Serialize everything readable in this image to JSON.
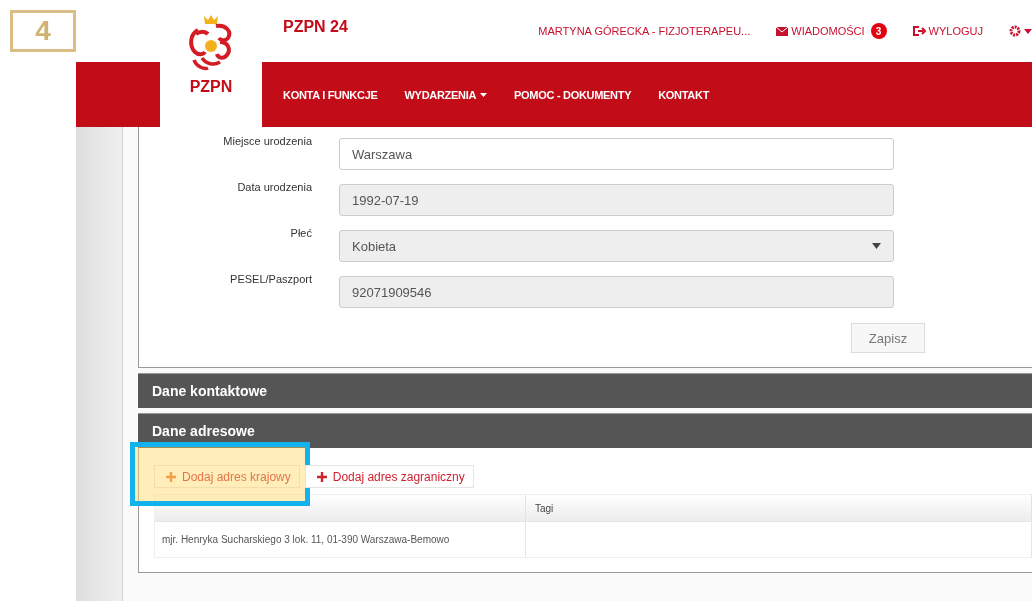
{
  "step_badge": "4",
  "header": {
    "logo_text": "PZPN",
    "app_title": "PZPN 24",
    "user": "MARTYNA GÓRECKA - FIZJOTERAPEU...",
    "messages": {
      "label": "WIADOMOŚCI",
      "count": "3"
    },
    "logout": "WYLOGUJ"
  },
  "nav": [
    {
      "label": "KONTA I FUNKCJE",
      "dropdown": false
    },
    {
      "label": "WYDARZENIA",
      "dropdown": true
    },
    {
      "label": "POMOC - DOKUMENTY",
      "dropdown": false
    },
    {
      "label": "KONTAKT",
      "dropdown": false
    }
  ],
  "form": {
    "fields": [
      {
        "label": "Miejsce urodzenia",
        "value": "Warszawa",
        "kind": "text",
        "disabled": false
      },
      {
        "label": "Data urodzenia",
        "value": "1992-07-19",
        "kind": "text",
        "disabled": true
      },
      {
        "label": "Płeć",
        "value": "Kobieta",
        "kind": "select",
        "disabled": true
      },
      {
        "label": "PESEL/Paszport",
        "value": "92071909546",
        "kind": "text",
        "disabled": true
      }
    ],
    "save_button": "Zapisz"
  },
  "sections": [
    {
      "title": "Dane kontaktowe"
    },
    {
      "title": "Dane adresowe"
    }
  ],
  "address": {
    "buttons": [
      {
        "label": "Dodaj adres krajowy",
        "highlighted": true
      },
      {
        "label": "Dodaj adres zagraniczny",
        "highlighted": false
      }
    ],
    "table": {
      "column_2": "Tagi",
      "rows": [
        {
          "column_1": "mjr. Henryka Sucharskiego 3 lok. 11, 01-390 Warszawa-Bemowo"
        }
      ]
    }
  }
}
